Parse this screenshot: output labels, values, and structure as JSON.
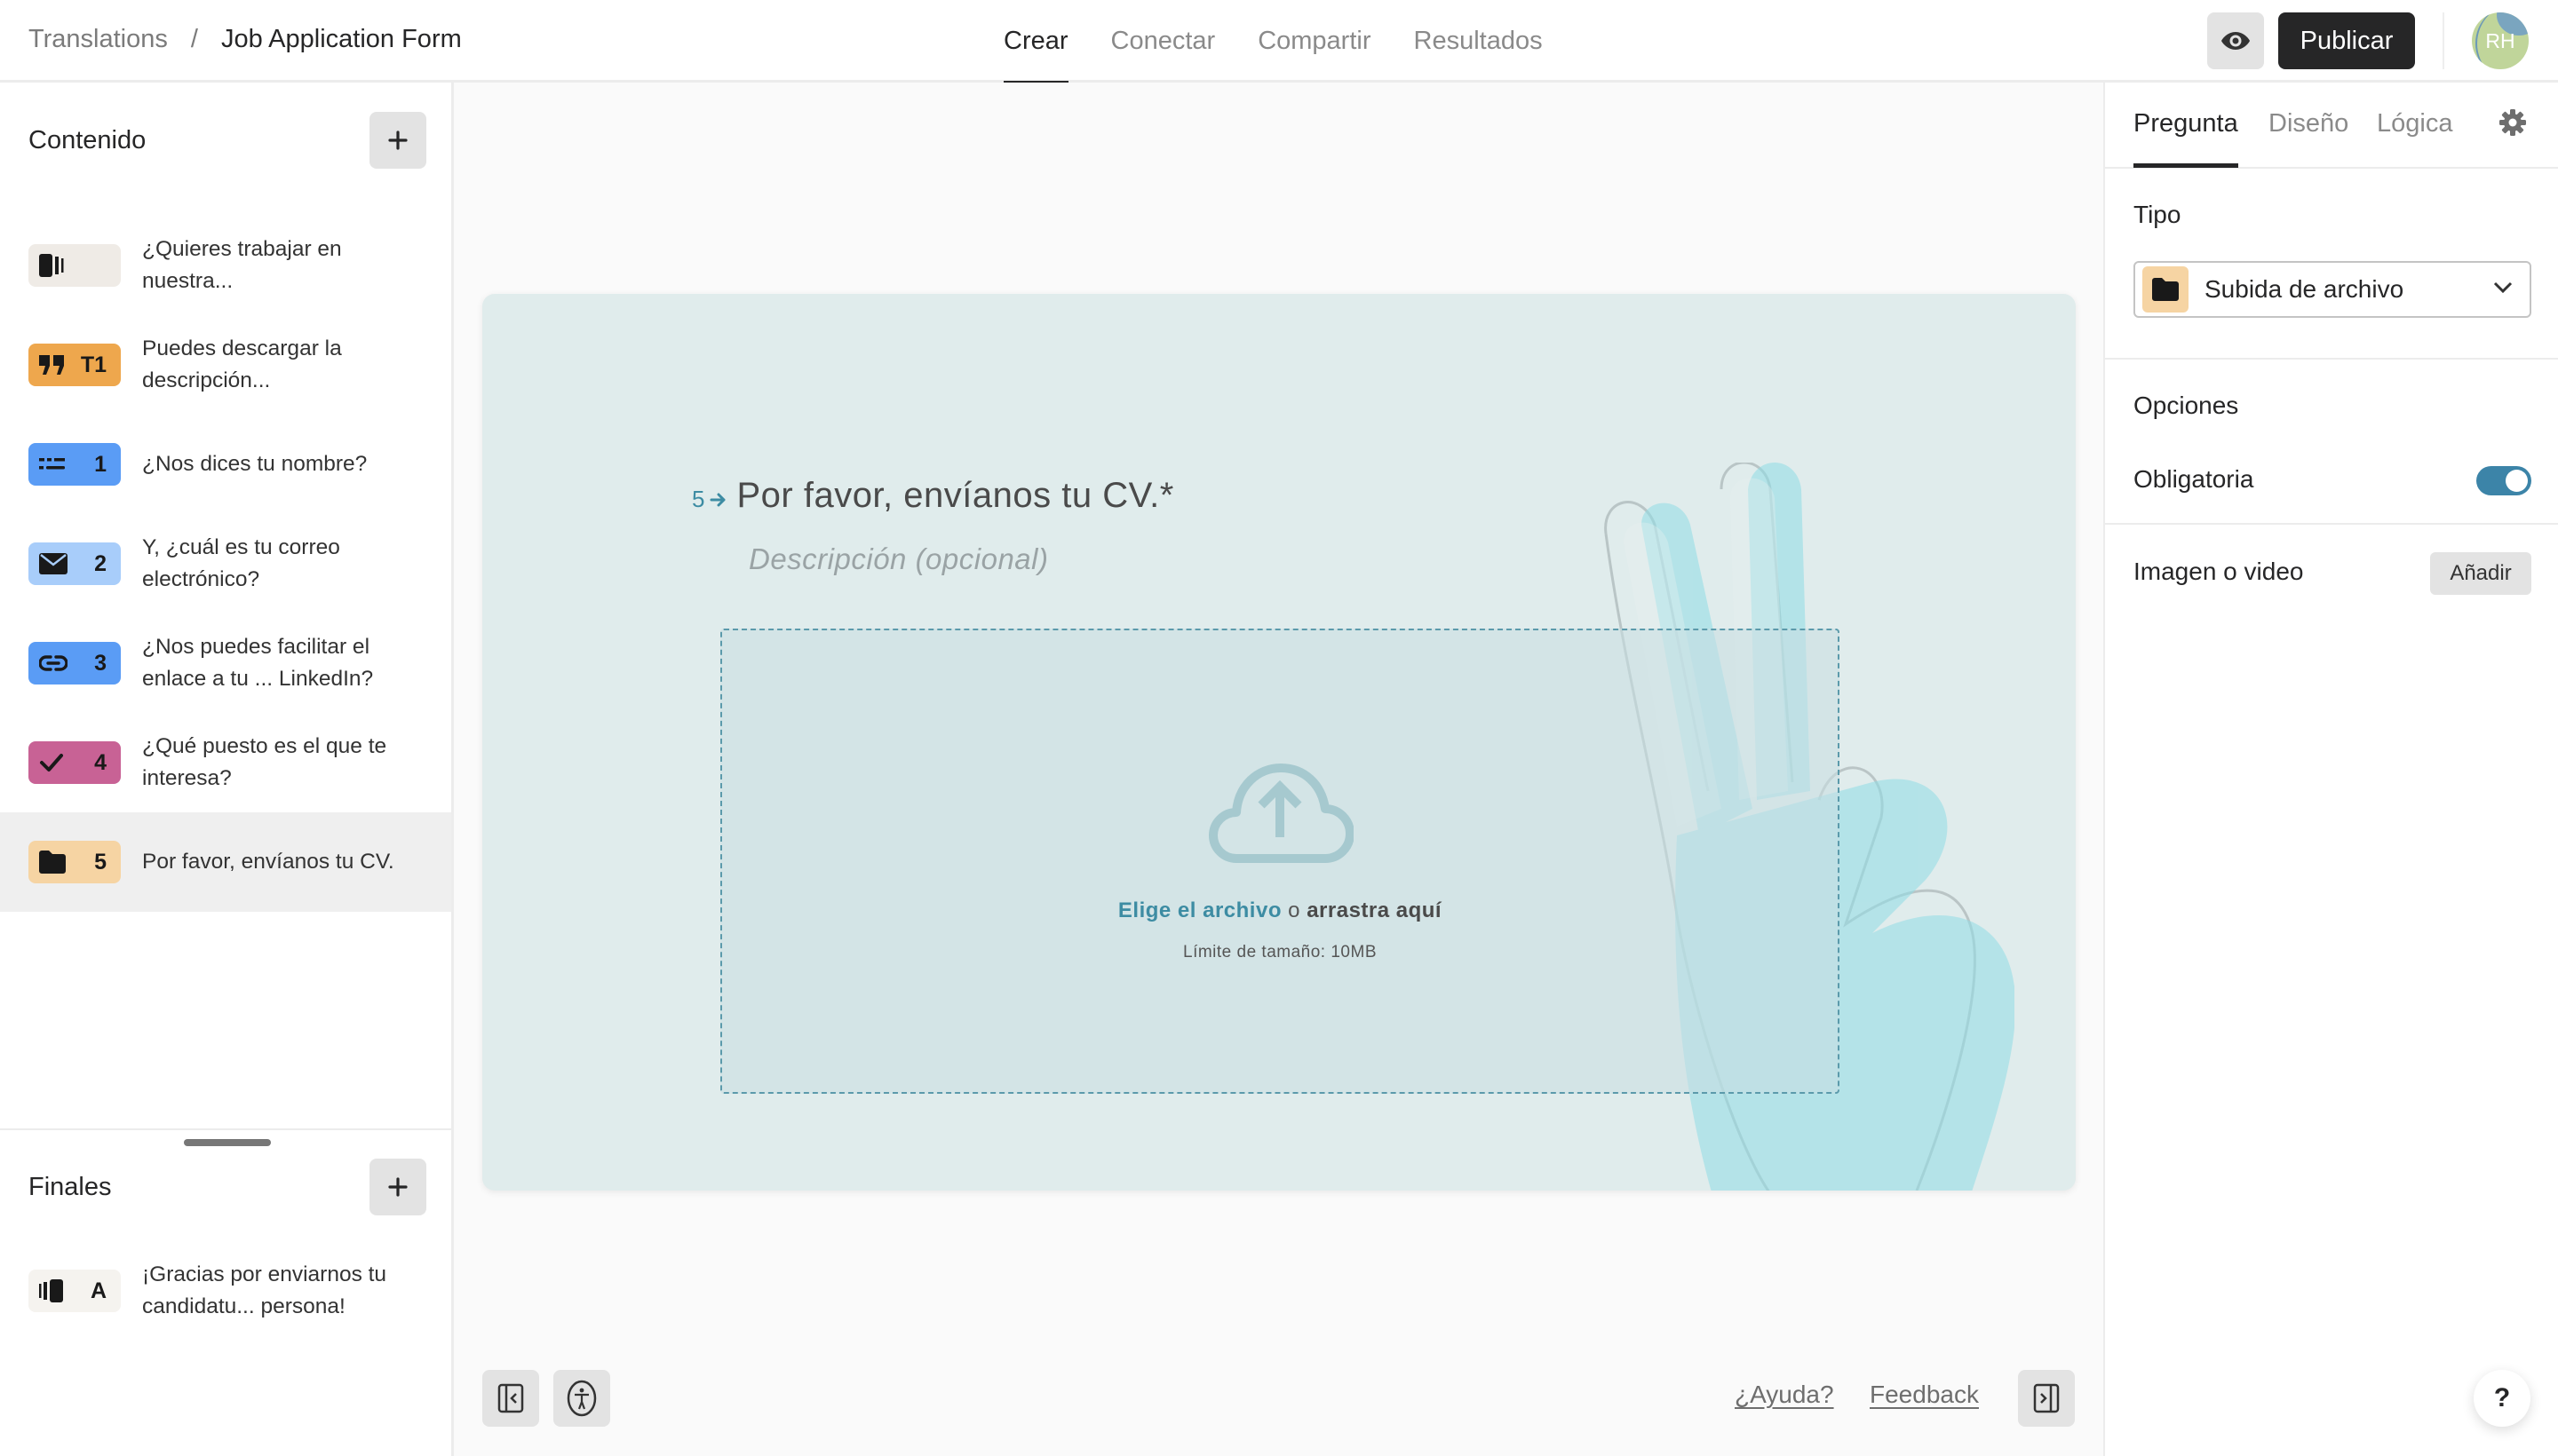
{
  "header": {
    "breadcrumb_root": "Translations",
    "breadcrumb_separator": "/",
    "form_title": "Job Application Form",
    "tabs": [
      {
        "label": "Crear",
        "active": true
      },
      {
        "label": "Conectar",
        "active": false
      },
      {
        "label": "Compartir",
        "active": false
      },
      {
        "label": "Resultados",
        "active": false
      }
    ],
    "preview_icon": "eye-icon",
    "publish_label": "Publicar",
    "avatar_initials": "RH"
  },
  "sidebar": {
    "content_title": "Contenido",
    "add_icon": "plus-icon",
    "blocks": [
      {
        "icon": "welcome-screen-icon",
        "number": "",
        "text": "¿Quieres trabajar en nuestra...",
        "color": "#efebe6",
        "selected": false
      },
      {
        "icon": "quote-icon",
        "number": "T1",
        "text": "Puedes descargar la descripción...",
        "color": "#eea74d",
        "selected": false
      },
      {
        "icon": "short-text-icon",
        "number": "1",
        "text": "¿Nos dices tu nombre?",
        "color": "#5a9cf5",
        "selected": false
      },
      {
        "icon": "email-icon",
        "number": "2",
        "text": "Y, ¿cuál es tu correo electrónico?",
        "color": "#a8cdfa",
        "selected": false
      },
      {
        "icon": "link-icon",
        "number": "3",
        "text": "¿Nos puedes facilitar el enlace a tu ... LinkedIn?",
        "color": "#5a9cf5",
        "selected": false
      },
      {
        "icon": "checkmark-icon",
        "number": "4",
        "text": "¿Qué puesto es el que te interesa?",
        "color": "#c86295",
        "selected": false
      },
      {
        "icon": "folder-icon",
        "number": "5",
        "text": "Por favor, envíanos tu CV.",
        "color": "#f6d4a3",
        "selected": true
      }
    ],
    "endings_title": "Finales",
    "endings": [
      {
        "icon": "ending-screen-icon",
        "number": "A",
        "text": "¡Gracias por enviarnos tu candidatu... persona!",
        "color": "#f5f3ef"
      }
    ]
  },
  "canvas": {
    "question_number": "5",
    "question_title": "Por favor, envíanos tu CV.*",
    "description_placeholder": "Descripción (opcional)",
    "upload": {
      "choose_link": "Elige el archivo",
      "or": "o",
      "drag_text": "arrastra aquí",
      "size_limit": "Límite de tamaño: 10MB"
    },
    "accent_color": "#3d8ca3",
    "card_background": "#e0ecec",
    "help_link": "¿Ayuda?",
    "feedback_link": "Feedback"
  },
  "panel": {
    "tabs": [
      {
        "label": "Pregunta",
        "active": true
      },
      {
        "label": "Diseño",
        "active": false
      },
      {
        "label": "Lógica",
        "active": false
      }
    ],
    "type_label": "Tipo",
    "type_value": "Subida de archivo",
    "options_label": "Opciones",
    "required_label": "Obligatoria",
    "required_on": true,
    "media_label": "Imagen o video",
    "media_add_label": "Añadir",
    "toggle_color": "#3c84a8"
  },
  "help_fab_label": "?"
}
